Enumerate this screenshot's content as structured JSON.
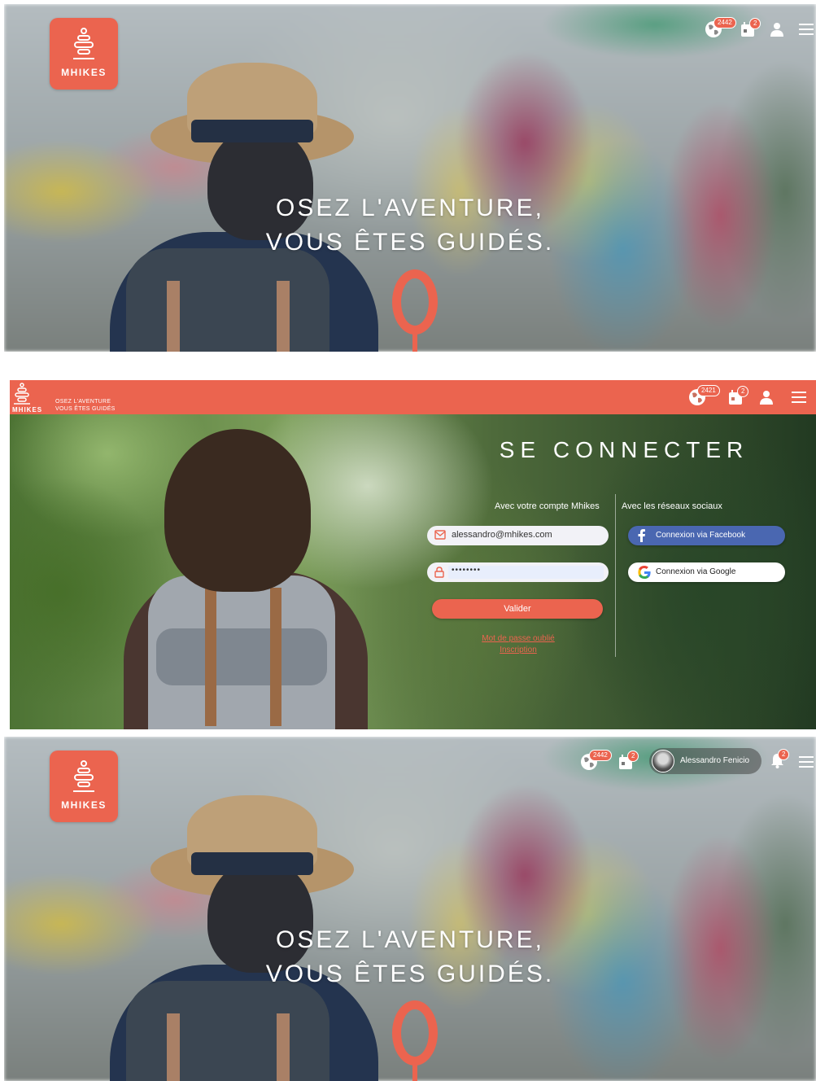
{
  "brand": {
    "logo_text": "MHIKES",
    "tagline_line1": "OSEZ L'AVENTURE,",
    "tagline_line2": "VOUS ÊTES GUIDÉS.",
    "small_tag_line1": "OSEZ L'AVENTURE",
    "small_tag_line2": "VOUS ÊTES GUIDÉS",
    "accent_color": "#eb644f"
  },
  "nav": {
    "globe_badge": "2442",
    "globe_badge_login": "2421",
    "calendar_badge": "2",
    "notification_badge": "2",
    "icons": [
      "globe-icon",
      "calendar-icon",
      "user-icon",
      "menu-icon",
      "bell-icon"
    ]
  },
  "login": {
    "title": "SE CONNECTER",
    "mhikes_account_label": "Avec votre compte Mhikes",
    "social_label": "Avec les réseaux sociaux",
    "email_value": "alessandro@mhikes.com",
    "password_value": "••••••••",
    "submit_label": "Valider",
    "forgot_line1": "Mot de passe oublié",
    "forgot_line2": "Inscription",
    "facebook_label": "Connexion via Facebook",
    "google_label": "Connexion via Google"
  },
  "user": {
    "name": "Alessandro Fenicio"
  }
}
